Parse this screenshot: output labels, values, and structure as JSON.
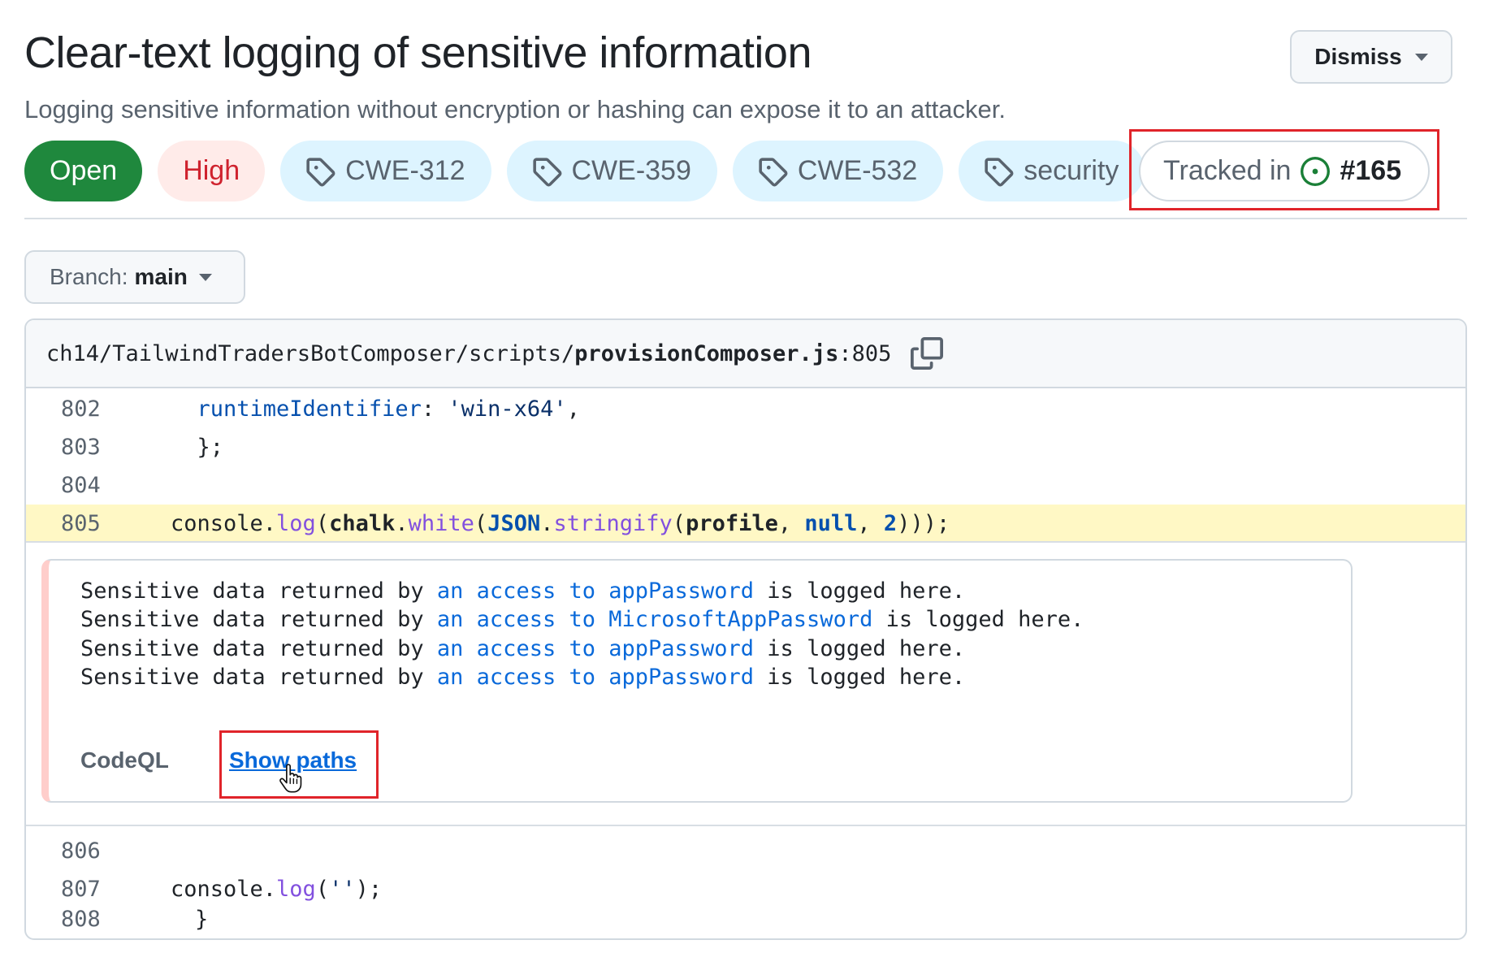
{
  "alert": {
    "title": "Clear-text logging of sensitive information",
    "description": "Logging sensitive information without encryption or hashing can expose it to an attacker.",
    "dismiss_label": "Dismiss"
  },
  "labels": {
    "status": "Open",
    "severity": "High",
    "tags": [
      "CWE-312",
      "CWE-359",
      "CWE-532",
      "security"
    ],
    "tracked_prefix": "Tracked in",
    "tracked_issue": "#165"
  },
  "branch": {
    "prefix": "Branch:",
    "name": "main"
  },
  "file": {
    "path_prefix": "ch14/TailwindTradersBotComposer/scripts/",
    "file_name": "provisionComposer.js",
    "line_suffix": ":805"
  },
  "code": {
    "lines": [
      {
        "number": "802",
        "text": "    runtimeIdentifier: 'win-x64',"
      },
      {
        "number": "803",
        "text": "  };"
      },
      {
        "number": "804",
        "text": ""
      },
      {
        "number": "805",
        "text": "  console.log(chalk.white(JSON.stringify(profile, null, 2)));"
      },
      {
        "number": "806",
        "text": ""
      },
      {
        "number": "807",
        "text": "  console.log('');"
      },
      {
        "number": "808",
        "text": "}"
      }
    ]
  },
  "messages": [
    {
      "prefix": "Sensitive data returned by ",
      "link": "an access to appPassword",
      "suffix": " is logged here."
    },
    {
      "prefix": "Sensitive data returned by ",
      "link": "an access to MicrosoftAppPassword",
      "suffix": " is logged here."
    },
    {
      "prefix": "Sensitive data returned by ",
      "link": "an access to appPassword",
      "suffix": " is logged here."
    },
    {
      "prefix": "Sensitive data returned by ",
      "link": "an access to appPassword",
      "suffix": " is logged here."
    }
  ],
  "tool": {
    "name": "CodeQL",
    "show_paths_label": "Show paths"
  },
  "colors": {
    "open_green": "#1f883d",
    "high_red": "#cf222e",
    "tag_blue_bg": "#ddf4ff",
    "highlight_yellow": "#fff8c5",
    "link_blue": "#0969da",
    "annotation_red": "#e0242a"
  },
  "icons": [
    "tag-icon",
    "issue-opened-icon",
    "copy-icon",
    "caret-down-icon",
    "hand-cursor-icon"
  ]
}
